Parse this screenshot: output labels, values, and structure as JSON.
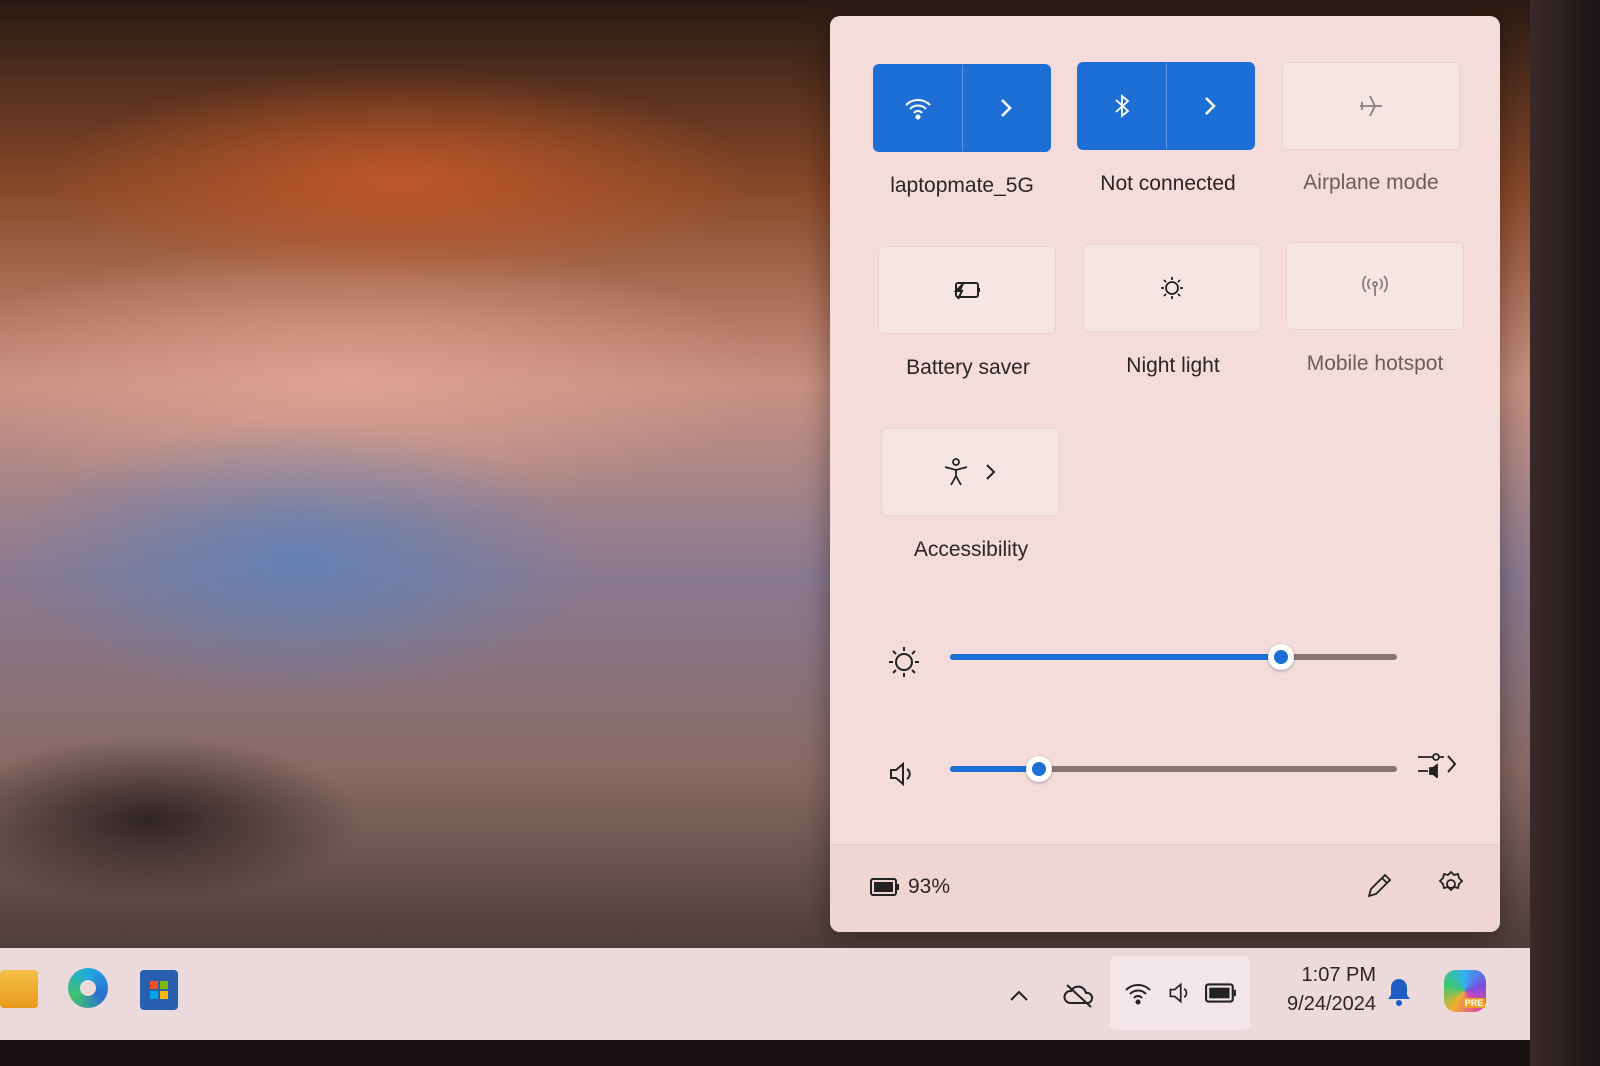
{
  "quick_settings": {
    "tiles": [
      {
        "label": "laptopmate_5G",
        "icon": "wifi-icon",
        "active": true,
        "expandable": true
      },
      {
        "label": "Not connected",
        "icon": "bluetooth-icon",
        "active": true,
        "expandable": true
      },
      {
        "label": "Airplane mode",
        "icon": "airplane-icon",
        "active": false,
        "disabled": true
      },
      {
        "label": "Battery saver",
        "icon": "battery-saver-icon",
        "active": false
      },
      {
        "label": "Night light",
        "icon": "night-light-icon",
        "active": false
      },
      {
        "label": "Mobile hotspot",
        "icon": "hotspot-icon",
        "active": false,
        "disabled": true
      },
      {
        "label": "Accessibility",
        "icon": "accessibility-icon",
        "active": false,
        "expandable": true
      }
    ],
    "brightness_percent": 74,
    "volume_percent": 20,
    "battery": "93%",
    "accent_color": "#1d6fd6"
  },
  "taskbar": {
    "pinned": [
      "file-explorer-icon",
      "edge-icon",
      "store-icon"
    ],
    "time": "1:07 PM",
    "date": "9/24/2024",
    "copilot_badge": "PRE"
  }
}
